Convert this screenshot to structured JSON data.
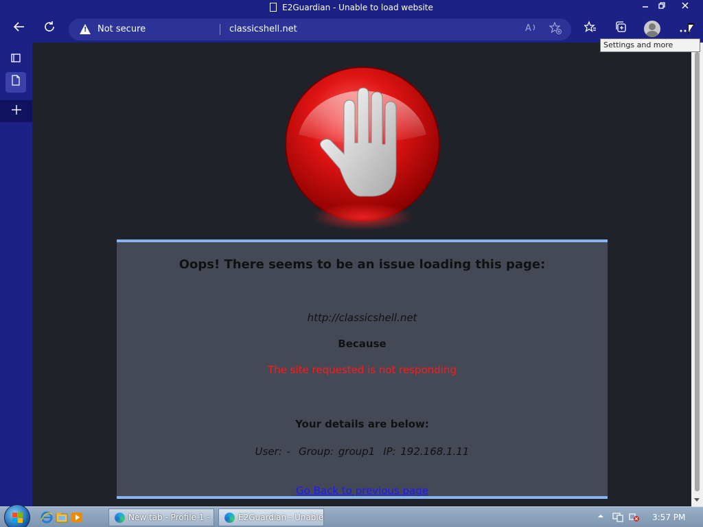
{
  "window": {
    "title": "E2Guardian - Unable to load website",
    "minimize_icon": "minimize-icon",
    "restore_icon": "restore-icon",
    "close_icon": "close-icon"
  },
  "toolbar": {
    "back_icon": "arrow-left-icon",
    "refresh_icon": "refresh-icon",
    "security_label": "Not secure",
    "url": "classicshell.net",
    "read_aloud_icon": "read-aloud-icon",
    "add_favorite_icon": "star-plus-icon",
    "favorites_icon": "favorites-icon",
    "collections_icon": "collections-icon",
    "profile_icon": "profile-avatar",
    "more_icon": "more-dots-icon",
    "tooltip": "Settings and more (Alt+F)"
  },
  "sidebar": {
    "items": [
      {
        "name": "tab-actions-icon"
      },
      {
        "name": "page-tab-icon"
      },
      {
        "name": "new-tab-plus-icon"
      }
    ]
  },
  "page": {
    "heading": "Oops! There seems to be an issue loading this page:",
    "site": "http://classicshell.net",
    "because": "Because",
    "reason": "The site requested is not responding",
    "reason_color": "#ff1a1a",
    "details_heading": "Your details are below:",
    "user": "User: -",
    "group": "Group: group1",
    "ip": "IP: 192.168.1.11",
    "go_back": "Go Back to previous page"
  },
  "taskbar": {
    "tasks": [
      {
        "label": "New tab - Profile 1 - ..."
      },
      {
        "label": "E2Guardian - Unable ..."
      }
    ],
    "clock": "3:57 PM"
  },
  "colors": {
    "chrome": "#1c2185",
    "page_bg": "#1f2229",
    "card_bg": "#454956",
    "card_border": "#8ab4f0",
    "link": "#1a1aff"
  }
}
